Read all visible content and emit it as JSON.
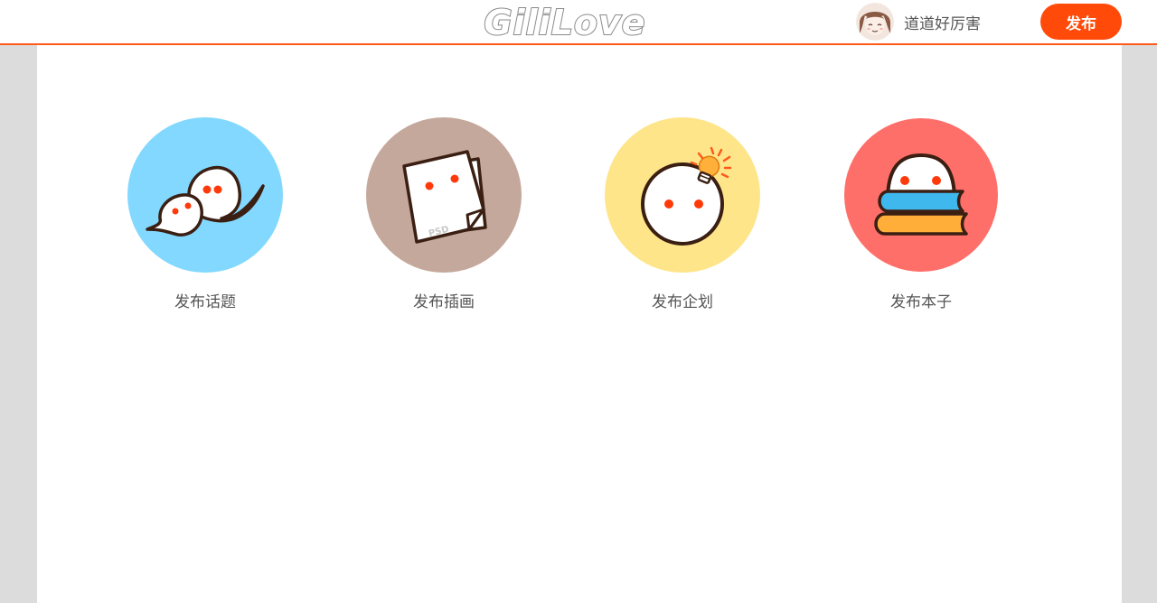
{
  "header": {
    "logo_text": "GiliLove",
    "username": "道道好厉害",
    "publish_label": "发布"
  },
  "options": [
    {
      "label": "发布话题",
      "icon": "speech-bubbles-icon",
      "color": "#82d8fe"
    },
    {
      "label": "发布插画",
      "icon": "paper-sheets-icon",
      "color": "#c5a89c"
    },
    {
      "label": "发布企划",
      "icon": "lightbulb-idea-icon",
      "color": "#fee58a"
    },
    {
      "label": "发布本子",
      "icon": "book-stack-icon",
      "color": "#ff6f6a"
    }
  ],
  "colors": {
    "accent": "#ff4a0a",
    "header_border": "#ff5a1a",
    "page_background": "#dcdcdc"
  }
}
